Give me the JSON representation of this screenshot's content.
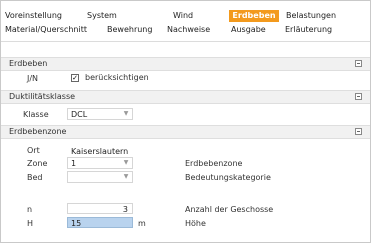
{
  "tabs_row1": [
    "Voreinstellung",
    "System",
    "Wind",
    "Erdbeben",
    "Belastungen"
  ],
  "tabs_row2": [
    "Material/Querschnitt",
    "Bewehrung",
    "Nachweise",
    "Ausgabe",
    "Erläuterung"
  ],
  "active_tab": "Erdbeben",
  "sections": {
    "erdbeben": {
      "title": "Erdbeben",
      "jn_label": "J/N",
      "checkbox_checked": true,
      "checkbox_label": "berücksichtigen"
    },
    "duktilitaet": {
      "title": "Duktilitätsklasse",
      "klasse_label": "Klasse",
      "klasse_value": "DCL"
    },
    "erdbebenzone": {
      "title": "Erdbebenzone",
      "ort_label": "Ort",
      "ort_value": "Kaiserslautern",
      "zone_label": "Zone",
      "zone_value": "1",
      "zone_desc": "Erdbebenzone",
      "bed_label": "Bed",
      "bed_value": "",
      "bed_desc": "Bedeutungskategorie",
      "n_label": "n",
      "n_value": "3",
      "n_desc": "Anzahl der Geschosse",
      "h_label": "H",
      "h_value": "15",
      "h_unit": "m",
      "h_desc": "Höhe"
    }
  },
  "colors": {
    "accent": "#f39a1d",
    "highlight": "#b9d3ee"
  }
}
